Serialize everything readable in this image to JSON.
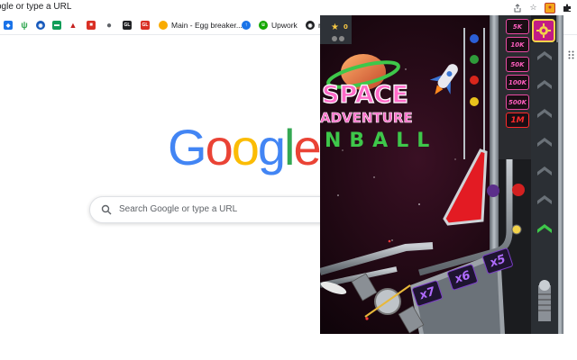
{
  "address_bar": {
    "url_text": "ogle or type a URL",
    "icons": [
      "share-icon",
      "bookmark-star-icon",
      "extension-pinball-icon",
      "extensions-puzzle-icon"
    ]
  },
  "bookmarks": [
    {
      "icon": "cube-icon",
      "label": "",
      "color": "#1a73e8"
    },
    {
      "icon": "cactus-icon",
      "label": "",
      "color": "#34a853"
    },
    {
      "icon": "globe-icon",
      "label": "",
      "color": "#185abc"
    },
    {
      "icon": "car-icon",
      "label": "",
      "color": "#0f9d58"
    },
    {
      "icon": "ship-icon",
      "label": "",
      "color": "#c5221f"
    },
    {
      "icon": "red-square-icon",
      "label": "",
      "color": "#d93025"
    },
    {
      "icon": "apple-icon",
      "label": "",
      "color": "#5f6368"
    },
    {
      "icon": "gl-icon",
      "label": "GL",
      "color": "#202124"
    },
    {
      "icon": "gl-red-icon",
      "label": "GL",
      "color": "#d93025"
    },
    {
      "icon": "egg-breaker-icon",
      "label": "Main - Egg breaker...",
      "color": "#f9ab00"
    },
    {
      "icon": "upload-icon",
      "label": "",
      "color": "#1a73e8"
    },
    {
      "icon": "upwork-icon",
      "label": "Upwork",
      "color": "#14a800"
    },
    {
      "icon": "globe-dark-icon",
      "label": "n",
      "color": "#202124"
    }
  ],
  "google": {
    "logo_letters": [
      {
        "ch": "G",
        "color": "#4285f4"
      },
      {
        "ch": "o",
        "color": "#ea4335"
      },
      {
        "ch": "o",
        "color": "#fbbc05"
      },
      {
        "ch": "g",
        "color": "#4285f4"
      },
      {
        "ch": "l",
        "color": "#34a853"
      },
      {
        "ch": "e",
        "color": "#ea4335"
      }
    ],
    "search_placeholder": "Search Google or type a URL"
  },
  "game": {
    "title_line1": "SPACE",
    "title_line2": "ADVENTURE",
    "title_line3": "NBALL",
    "score": "0",
    "score_sub": "00",
    "multipliers": [
      "5K",
      "10K",
      "50K",
      "100K",
      "500K",
      "1M"
    ],
    "bonus_multipliers": [
      "x7",
      "x6",
      "x5"
    ],
    "colors": {
      "accent_pink": "#ff5fbf",
      "accent_magenta": "#c21c86",
      "flipper_red": "#e31b23",
      "metal": "#9aa1a8"
    }
  }
}
